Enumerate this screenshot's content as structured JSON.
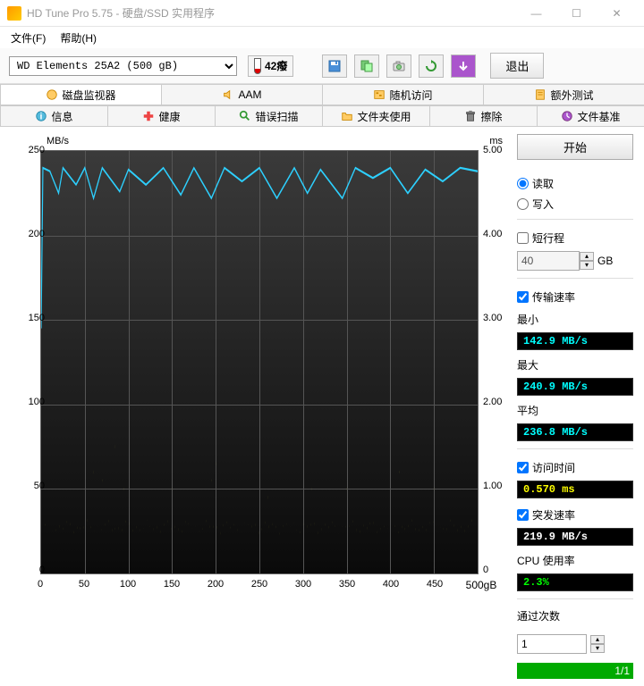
{
  "window": {
    "title": "HD Tune Pro 5.75 - 硬盘/SSD 实用程序"
  },
  "menu": {
    "file": "文件(F)",
    "help": "帮助(H)"
  },
  "toolbar": {
    "drive": "WD    Elements 25A2 (500 gB)",
    "temperature": "42癈",
    "exit": "退出"
  },
  "icons": {
    "save": "save",
    "copy": "copy",
    "screenshot": "camera",
    "refresh": "refresh",
    "down": "down"
  },
  "tabs_row1": [
    {
      "label": "磁盘监视器",
      "icon": "monitor",
      "active": true
    },
    {
      "label": "AAM",
      "icon": "speaker"
    },
    {
      "label": "随机访问",
      "icon": "random"
    },
    {
      "label": "额外测试",
      "icon": "extra"
    }
  ],
  "tabs_row2": [
    {
      "label": "信息",
      "icon": "info"
    },
    {
      "label": "健康",
      "icon": "health"
    },
    {
      "label": "错误扫描",
      "icon": "scan"
    },
    {
      "label": "文件夹使用",
      "icon": "folder"
    },
    {
      "label": "擦除",
      "icon": "erase"
    },
    {
      "label": "文件基准",
      "icon": "bench"
    }
  ],
  "sidebar": {
    "start": "开始",
    "read": "读取",
    "write": "写入",
    "short_stroke": "短行程",
    "stroke_val": "40",
    "gb": "GB",
    "transfer_rate": "传输速率",
    "min_label": "最小",
    "min_val": "142.9 MB/s",
    "max_label": "最大",
    "max_val": "240.9 MB/s",
    "avg_label": "平均",
    "avg_val": "236.8 MB/s",
    "access_time": "访问时间",
    "access_val": "0.570 ms",
    "burst_rate": "突发速率",
    "burst_val": "219.9 MB/s",
    "cpu_label": "CPU 使用率",
    "cpu_val": "2.3%",
    "pass_label": "通过次数",
    "pass_val": "1",
    "progress": "1/1"
  },
  "chart_data": {
    "type": "line+scatter",
    "title": "",
    "xlabel": "gB",
    "ylabel_left": "MB/s",
    "ylabel_right": "ms",
    "xlim": [
      0,
      500
    ],
    "ylim_left": [
      0,
      250
    ],
    "ylim_right": [
      0,
      5.0
    ],
    "x_ticks": [
      0,
      50,
      100,
      150,
      200,
      250,
      300,
      350,
      400,
      450,
      500
    ],
    "y_ticks_left": [
      0,
      50,
      100,
      150,
      200,
      250
    ],
    "y_ticks_right": [
      0,
      1.0,
      2.0,
      3.0,
      4.0,
      5.0
    ],
    "series": [
      {
        "name": "transfer_rate_MBps",
        "axis": "left",
        "color": "#2dd0ff",
        "style": "line",
        "approx_values": [
          [
            0,
            145
          ],
          [
            2,
            240
          ],
          [
            10,
            238
          ],
          [
            20,
            225
          ],
          [
            25,
            240
          ],
          [
            40,
            230
          ],
          [
            50,
            240
          ],
          [
            60,
            222
          ],
          [
            70,
            240
          ],
          [
            90,
            226
          ],
          [
            100,
            239
          ],
          [
            120,
            230
          ],
          [
            140,
            240
          ],
          [
            160,
            224
          ],
          [
            175,
            240
          ],
          [
            195,
            222
          ],
          [
            210,
            240
          ],
          [
            230,
            232
          ],
          [
            250,
            240
          ],
          [
            270,
            222
          ],
          [
            290,
            240
          ],
          [
            305,
            225
          ],
          [
            320,
            239
          ],
          [
            345,
            222
          ],
          [
            360,
            240
          ],
          [
            380,
            234
          ],
          [
            400,
            240
          ],
          [
            420,
            225
          ],
          [
            440,
            239
          ],
          [
            460,
            232
          ],
          [
            480,
            240
          ],
          [
            500,
            238
          ]
        ]
      },
      {
        "name": "access_time_ms",
        "axis": "right",
        "color": "#ffff40",
        "style": "scatter",
        "approx_baseline": 0.55,
        "outliers": [
          [
            60,
            1.2
          ],
          [
            70,
            1.1
          ],
          [
            85,
            1.5
          ],
          [
            95,
            1.0
          ],
          [
            150,
            1.0
          ],
          [
            195,
            1.1
          ],
          [
            200,
            1.3
          ],
          [
            260,
            0.9
          ],
          [
            310,
            1.0
          ],
          [
            350,
            1.0
          ],
          [
            410,
            1.2
          ],
          [
            450,
            1.0
          ]
        ]
      }
    ]
  }
}
